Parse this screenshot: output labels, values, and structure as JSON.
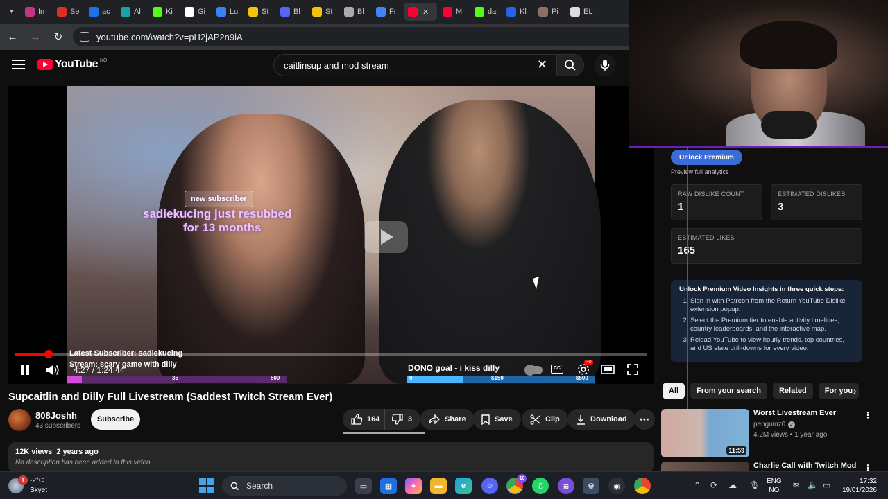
{
  "browser": {
    "tabs": [
      {
        "label": "In",
        "color": "#c13584",
        "icon": "instagram-icon"
      },
      {
        "label": "Se",
        "color": "#d93025",
        "icon": "gmail-icon"
      },
      {
        "label": "ac",
        "color": "#1a73e8",
        "icon": "search-icon"
      },
      {
        "label": "Al",
        "color": "#1aa3a3",
        "icon": "app-icon"
      },
      {
        "label": "Ki",
        "color": "#53fc18",
        "icon": "kick-icon"
      },
      {
        "label": "Gi",
        "color": "#ffffff",
        "icon": "document-icon"
      },
      {
        "label": "Lu",
        "color": "#3b82f6",
        "icon": "wave-icon"
      },
      {
        "label": "St",
        "color": "#f4c20d",
        "icon": "crown-icon"
      },
      {
        "label": "Bl",
        "color": "#5865f2",
        "icon": "app-icon"
      },
      {
        "label": "St",
        "color": "#f4c20d",
        "icon": "crown-icon"
      },
      {
        "label": "Bl",
        "color": "#aaaaaa",
        "icon": "openai-icon"
      },
      {
        "label": "Fr",
        "color": "#4285f4",
        "icon": "docs-icon"
      },
      {
        "label": "",
        "color": "#ff0033",
        "icon": "youtube-icon",
        "active": true
      },
      {
        "label": "M",
        "color": "#ff0033",
        "icon": "youtube-icon"
      },
      {
        "label": "da",
        "color": "#53fc18",
        "icon": "kick-icon"
      },
      {
        "label": "Kl",
        "color": "#2563eb",
        "icon": "app-icon"
      },
      {
        "label": "Pi",
        "color": "#8d6e63",
        "icon": "app-icon"
      },
      {
        "label": "EL",
        "color": "#dddddd",
        "icon": "window-icon"
      }
    ],
    "url": "youtube.com/watch?v=pH2jAP2n9iA"
  },
  "youtube": {
    "logo_text": "YouTube",
    "country": "NO",
    "search_value": "caitlinsup and mod stream"
  },
  "player": {
    "overlay": {
      "new_subscriber": "new subscriber",
      "resub_line1": "sadiekucing just resubbed",
      "resub_line2": "for 13 months",
      "latest_subscriber": "Latest Subscriber: sadiekucing",
      "stream_title": "Stream: scary game with dilly",
      "sub_goal_min": "35",
      "sub_goal_max": "500",
      "sub_goal_progress": 0.07,
      "dono_goal": "DONO goal - i kiss dilly",
      "dono_min": "0",
      "dono_mid": "$150",
      "dono_max": "$500",
      "dono_progress": 0.3
    },
    "time": "4:27 / 1:24:44",
    "progress": 0.053,
    "quality_badge": "HD",
    "cc_label": "CC"
  },
  "video": {
    "title": "Supcaitlin and Dilly Full Livestream (Saddest Twitch Stream Ever)",
    "channel": "808Joshh",
    "subscribers": "43 subscribers",
    "subscribe_label": "Subscribe",
    "likes": "164",
    "dislikes": "3",
    "share_label": "Share",
    "save_label": "Save",
    "clip_label": "Clip",
    "download_label": "Download",
    "stats": "12K views  2 years ago",
    "description": "No description has been added to this video."
  },
  "dislike_panel": {
    "unlock_label": "Unlock Premium",
    "preview_label": "Preview full analytics",
    "raw_dislike_label": "RAW DISLIKE COUNT",
    "raw_dislike_value": "1",
    "est_dislikes_label": "ESTIMATED DISLIKES",
    "est_dislikes_value": "3",
    "est_likes_label": "ESTIMATED LIKES",
    "est_likes_value": "165",
    "insights_title": "Unlock Premium Video Insights in three quick steps:",
    "steps": [
      "Sign in with Patreon from the Return YouTube Dislike extension popup.",
      "Select the Premium tier to enable activity timelines, country leaderboards, and the interactive map.",
      "Reload YouTube to view hourly trends, top countries, and US state drill-downs for every video."
    ]
  },
  "chips": [
    "All",
    "From your search",
    "Related",
    "For you"
  ],
  "recommendations": [
    {
      "title": "Worst Livestream Ever",
      "channel": "penguinz0",
      "meta": "4.2M views • 1 year ago",
      "duration": "11:59"
    },
    {
      "title": "Charlie Call with Twitch Mod",
      "channel": "",
      "meta": "",
      "duration": ""
    }
  ],
  "taskbar": {
    "weather_badge": "1",
    "temp": "-2°C",
    "condition": "Skyet",
    "search_label": "Search",
    "lang_line1": "ENG",
    "lang_line2": "NO",
    "time": "17:32",
    "date": "19/01/2026",
    "teams_count": "10"
  }
}
